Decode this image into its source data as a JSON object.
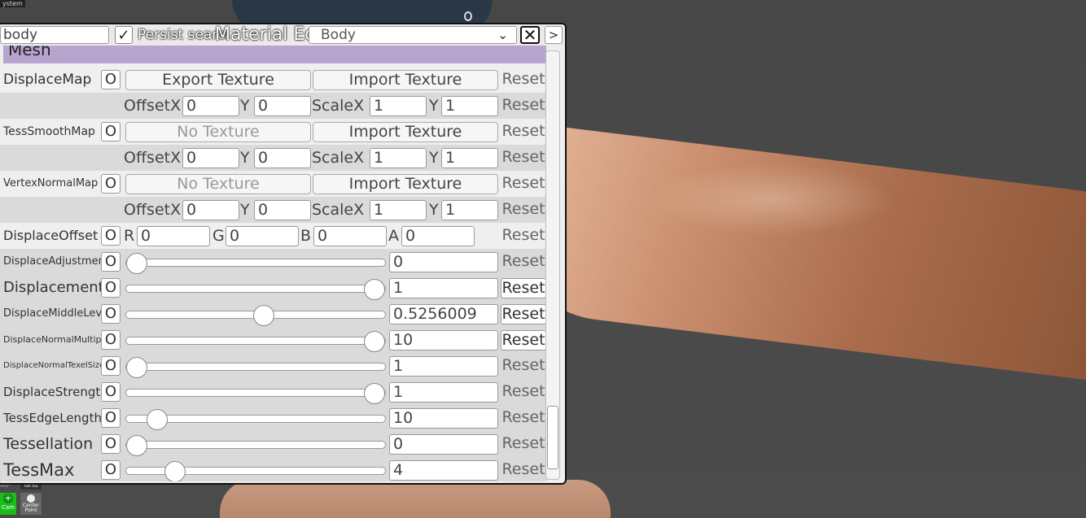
{
  "overlay": {
    "system_label": "ystem",
    "map_label": "IAP",
    "grid_label": "Grid",
    "cam_label": "Cam",
    "center_point_label": "Center Point"
  },
  "window": {
    "search_value": "body",
    "persist_label": "Persist search",
    "title": "Material Editor",
    "target_select": "Body",
    "close_label": "✕",
    "more_label": ">"
  },
  "section": {
    "title": "Mesh"
  },
  "common": {
    "o_label": "O",
    "reset_label": "Reset",
    "offset_x": "OffsetX",
    "y": "Y",
    "scale_x": "ScaleX"
  },
  "textures": [
    {
      "name": "DisplaceMap",
      "left_button": "Export Texture",
      "left_enabled": true,
      "import_label": "Import Texture",
      "offset_x": "0",
      "offset_y": "0",
      "scale_x": "1",
      "scale_y": "1"
    },
    {
      "name": "TessSmoothMap",
      "left_button": "No Texture",
      "left_enabled": false,
      "import_label": "Import Texture",
      "offset_x": "0",
      "offset_y": "0",
      "scale_x": "1",
      "scale_y": "1"
    },
    {
      "name": "VertexNormalMap",
      "left_button": "No Texture",
      "left_enabled": false,
      "import_label": "Import Texture",
      "offset_x": "0",
      "offset_y": "0",
      "scale_x": "1",
      "scale_y": "1"
    }
  ],
  "displace_offset": {
    "name": "DisplaceOffset",
    "labels": [
      "R",
      "G",
      "B",
      "A"
    ],
    "values": [
      "0",
      "0",
      "0",
      "0"
    ]
  },
  "sliders": [
    {
      "name": "DisplaceAdjustment",
      "value": "0",
      "fraction": 0.04,
      "reset_active": false
    },
    {
      "name": "Displacement",
      "value": "1",
      "fraction": 0.96,
      "reset_active": true
    },
    {
      "name": "DisplaceMiddleLevel",
      "value": "0.5256009",
      "fraction": 0.53,
      "reset_active": true
    },
    {
      "name": "DisplaceNormalMultiplier",
      "value": "10",
      "fraction": 0.96,
      "reset_active": true
    },
    {
      "name": "DisplaceNormalTexelSize",
      "value": "1",
      "fraction": 0.04,
      "reset_active": false
    },
    {
      "name": "DisplaceStrength",
      "value": "1",
      "fraction": 0.96,
      "reset_active": false
    },
    {
      "name": "TessEdgeLength",
      "value": "10",
      "fraction": 0.12,
      "reset_active": false
    },
    {
      "name": "Tessellation",
      "value": "0",
      "fraction": 0.04,
      "reset_active": false
    },
    {
      "name": "TessMax",
      "value": "4",
      "fraction": 0.19,
      "reset_active": false
    }
  ],
  "scroll": {
    "position_fraction": 0.9
  },
  "colors": {
    "section_header": "#b9a3cf",
    "cam_button": "#1bbd1b",
    "window_bg": "#efefef"
  }
}
